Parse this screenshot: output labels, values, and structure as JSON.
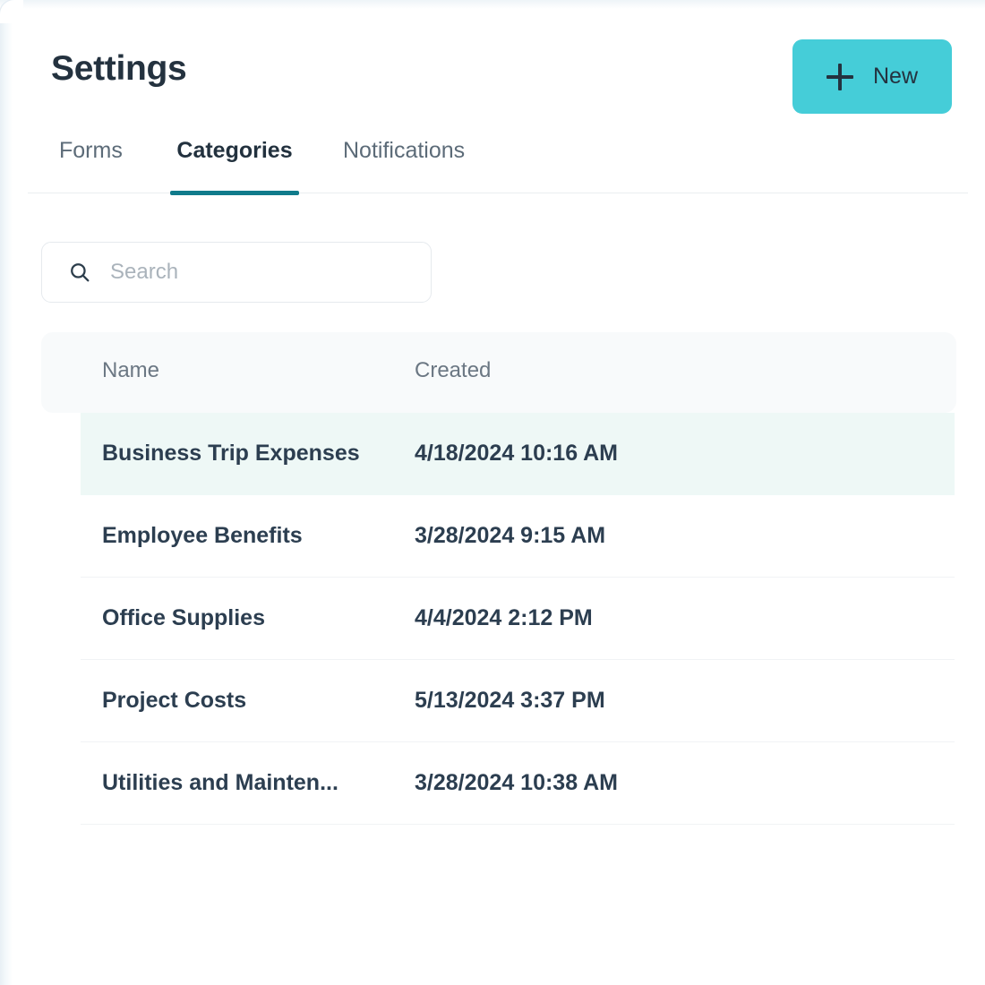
{
  "header": {
    "title": "Settings",
    "new_button": {
      "label": "New",
      "icon": "plus-icon",
      "bg_color": "#45cdd8",
      "text_color": "#24323f"
    }
  },
  "tabs": {
    "active_index": 1,
    "accent_color": "#107b8b",
    "items": [
      {
        "label": "Forms"
      },
      {
        "label": "Categories"
      },
      {
        "label": "Notifications"
      }
    ]
  },
  "search": {
    "placeholder": "Search",
    "value": "",
    "icon": "search-icon"
  },
  "table": {
    "columns": [
      {
        "key": "name",
        "label": "Name"
      },
      {
        "key": "created",
        "label": "Created"
      }
    ],
    "highlight_color": "#eef8f6",
    "rows": [
      {
        "name": "Business Trip Expenses",
        "created": "4/18/2024 10:16 AM",
        "highlighted": true
      },
      {
        "name": "Employee Benefits",
        "created": "3/28/2024 9:15 AM",
        "highlighted": false
      },
      {
        "name": "Office Supplies",
        "created": "4/4/2024 2:12 PM",
        "highlighted": false
      },
      {
        "name": "Project Costs",
        "created": "5/13/2024 3:37 PM",
        "highlighted": false
      },
      {
        "name": "Utilities and Mainten...",
        "created": "3/28/2024 10:38 AM",
        "highlighted": false
      }
    ]
  }
}
